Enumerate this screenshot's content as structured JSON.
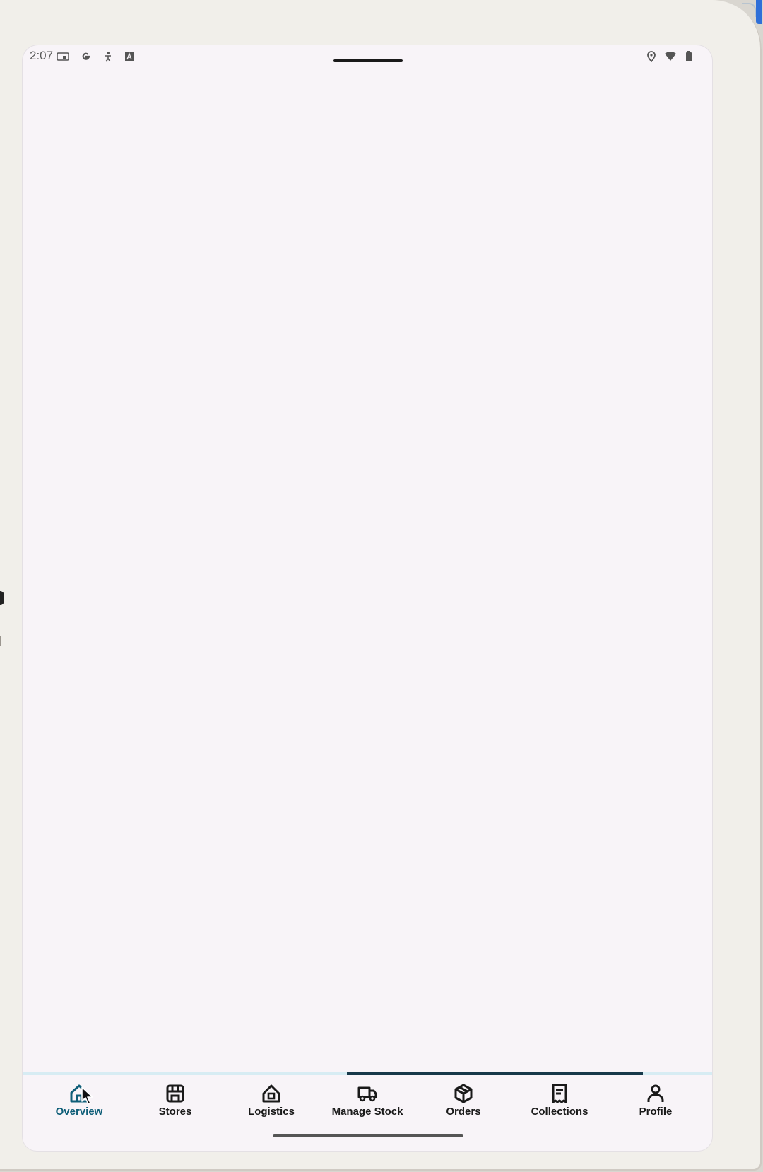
{
  "status_bar": {
    "time": "2:07",
    "left_icons": [
      "cast-icon",
      "google-icon",
      "accessibility-icon",
      "keyboard-icon"
    ],
    "right_icons": [
      "location-icon",
      "wifi-icon",
      "battery-icon"
    ]
  },
  "loading": {
    "progress_start": 0.47,
    "progress_end": 0.9
  },
  "bottom_nav": {
    "active": "overview",
    "items": [
      {
        "key": "overview",
        "label": "Overview",
        "icon": "home-icon"
      },
      {
        "key": "stores",
        "label": "Stores",
        "icon": "store-icon"
      },
      {
        "key": "logistics",
        "label": "Logistics",
        "icon": "logistics-icon"
      },
      {
        "key": "manage_stock",
        "label": "Manage Stock",
        "icon": "truck-icon"
      },
      {
        "key": "orders",
        "label": "Orders",
        "icon": "package-icon"
      },
      {
        "key": "collections",
        "label": "Collections",
        "icon": "receipt-icon"
      },
      {
        "key": "profile",
        "label": "Profile",
        "icon": "person-icon"
      }
    ]
  },
  "colors": {
    "active_nav": "#0f5e78",
    "progress_track": "#d7ecf3",
    "progress_fill": "#17394a",
    "screen_bg": "#f8f4f8"
  }
}
